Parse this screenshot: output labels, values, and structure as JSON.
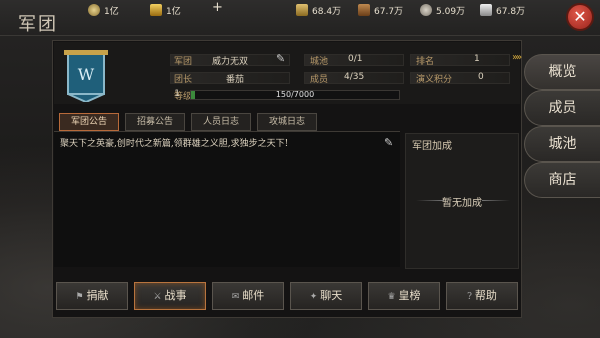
{
  "window": {
    "title": "军团"
  },
  "resources": [
    {
      "icon": "silver-coin-icon",
      "value": "1亿",
      "color": "#c9b27a"
    },
    {
      "icon": "gold-ingot-icon",
      "value": "1亿",
      "color": "#e0b84a"
    },
    {
      "icon": "grain-icon",
      "value": "68.4万",
      "color": "#d0b060"
    },
    {
      "icon": "wood-icon",
      "value": "67.7万",
      "color": "#b07a40"
    },
    {
      "icon": "stone-icon",
      "value": "5.09万",
      "color": "#bdb6a8"
    },
    {
      "icon": "iron-icon",
      "value": "67.8万",
      "color": "#d8d8d8"
    }
  ],
  "legion": {
    "name_label": "军团",
    "name": "威力无双",
    "city_label": "城池",
    "city": "0/1",
    "rank_label": "排名",
    "rank": "1",
    "leader_label": "团长",
    "leader": "番茄",
    "members_label": "成员",
    "members": "4/35",
    "points_label": "演义积分",
    "points": "0",
    "level_label": "等级",
    "level": "1",
    "xp_text": "150/7000",
    "xp_fraction": 0.021
  },
  "tabs": [
    "军团公告",
    "招募公告",
    "人员日志",
    "攻城日志"
  ],
  "notice": "聚天下之英豪,创时代之新篇,领群雄之义胆,求独步之天下!",
  "bonus": {
    "title": "军团加成",
    "empty": "暂无加成"
  },
  "bottom_buttons": [
    "捐献",
    "战事",
    "邮件",
    "聊天",
    "皇榜",
    "帮助"
  ],
  "side_tabs": [
    "概览",
    "成员",
    "城池",
    "商店"
  ]
}
